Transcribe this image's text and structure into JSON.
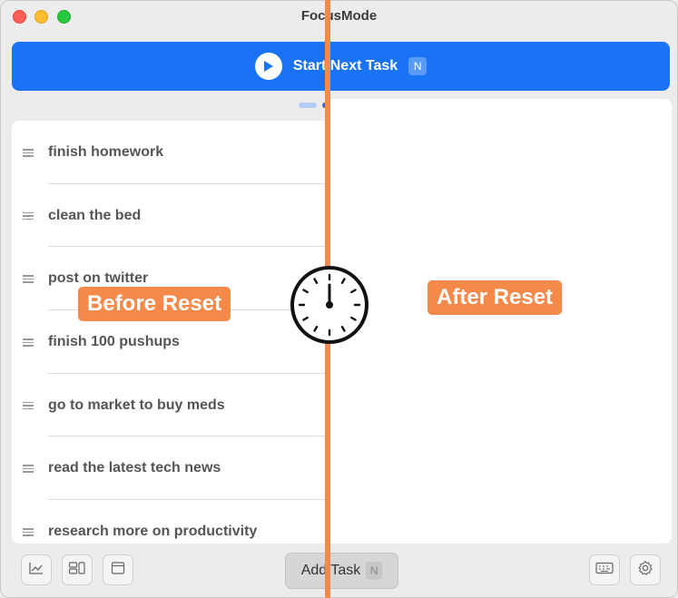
{
  "window": {
    "title": "FocusMode"
  },
  "start_button": {
    "label": "Start Next Task",
    "shortcut": "N"
  },
  "tasks": [
    {
      "label": "finish homework"
    },
    {
      "label": "clean the bed"
    },
    {
      "label": "post on twitter"
    },
    {
      "label": "finish 100 pushups"
    },
    {
      "label": "go to market to buy meds"
    },
    {
      "label": "read the latest tech news"
    },
    {
      "label": "research more on productivity"
    }
  ],
  "annotations": {
    "before": "Before Reset",
    "after": "After Reset"
  },
  "toolbar": {
    "add_task_label": "Add Task",
    "add_task_shortcut": "N",
    "icons": [
      "chart-icon",
      "layout-icon",
      "window-icon",
      "keyboard-icon",
      "gear-icon"
    ]
  },
  "colors": {
    "accent": "#1a73f5",
    "annotation": "#f5894a",
    "text": "#555555"
  }
}
